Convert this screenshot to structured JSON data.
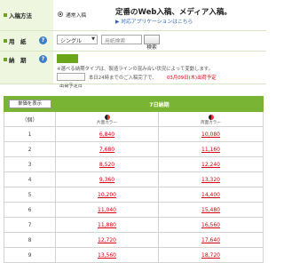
{
  "printing_method": {
    "label": "入稿方法",
    "option": "通常入稿",
    "headline": "定番のWeb入稿、メディア入稿。",
    "app_link": "▶ 対応アプリケーションはこちら"
  },
  "paper": {
    "label": "用　紙",
    "type_value": "シングル",
    "paper_placeholder": "用紙検索",
    "search_button": "検索"
  },
  "delivery": {
    "label": "納　期",
    "tag": "7日納期",
    "note": "※選べる納期タイプは、製造ラインの混み合い状況によって変動します。",
    "schedule_label": "出荷予定日",
    "schedule_text_prefix": "本日24時までのご入稿完了で、",
    "schedule_date": "03月09日(木)出荷予定"
  },
  "table": {
    "show_button": "単価を表示",
    "header_title": "7日納期",
    "qty_header": "（個）",
    "col1_label": "片面カラー",
    "col2_label": "両面カラー",
    "rows": [
      {
        "qty": "1",
        "single": "6,840",
        "double": "10,080"
      },
      {
        "qty": "2",
        "single": "7,680",
        "double": "11,160"
      },
      {
        "qty": "3",
        "single": "8,520",
        "double": "12,240"
      },
      {
        "qty": "4",
        "single": "9,360",
        "double": "13,320"
      },
      {
        "qty": "5",
        "single": "10,200",
        "double": "14,400"
      },
      {
        "qty": "6",
        "single": "11,040",
        "double": "15,480"
      },
      {
        "qty": "7",
        "single": "11,880",
        "double": "16,560"
      },
      {
        "qty": "8",
        "single": "12,720",
        "double": "17,640"
      },
      {
        "qty": "9",
        "single": "13,560",
        "double": "18,720"
      }
    ]
  },
  "colors": {
    "accent_green": "#6aa51a",
    "header_green": "#7ab434",
    "price_red": "#d6000f"
  }
}
